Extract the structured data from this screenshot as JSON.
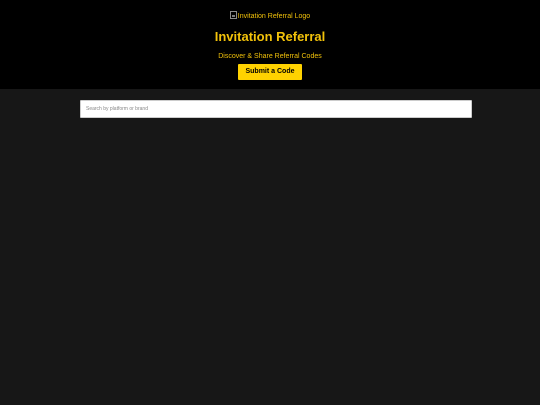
{
  "header": {
    "logo_alt": "Invitation Referral Logo",
    "title": "Invitation Referral",
    "tagline": "Discover & Share Referral Codes",
    "submit_label": "Submit a Code"
  },
  "search": {
    "placeholder": "Search by platform or brand",
    "value": ""
  },
  "colors": {
    "accent": "#ffd200",
    "header_bg": "#000000",
    "page_bg": "#171717"
  }
}
